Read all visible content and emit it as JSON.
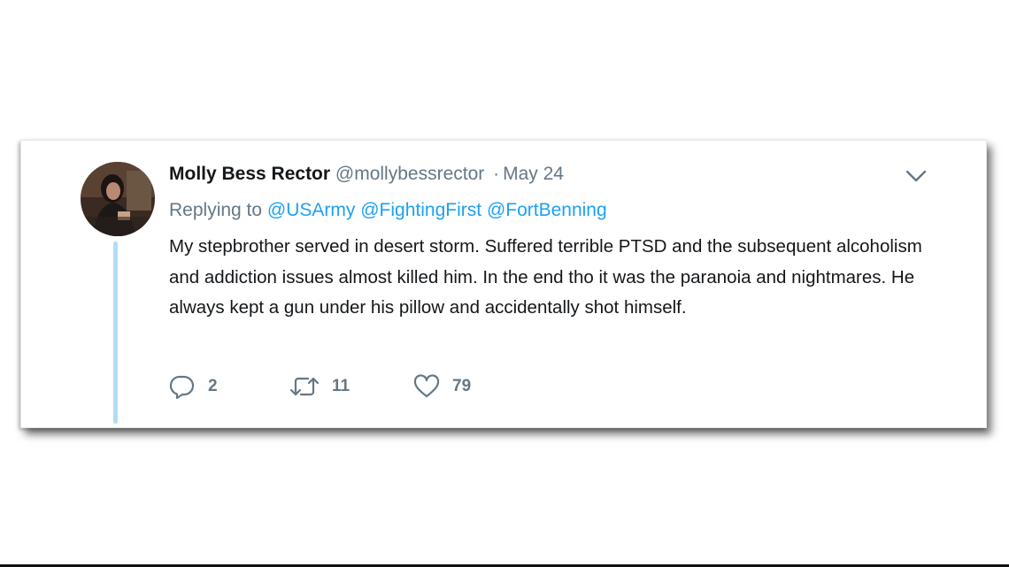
{
  "tweet": {
    "author_name": "Molly Bess Rector",
    "handle": "@mollybessrector",
    "separator": "·",
    "timestamp": "May 24",
    "replying_to_label": "Replying to",
    "mentions": [
      "@USArmy",
      "@FightingFirst",
      "@FortBenning"
    ],
    "text": "My stepbrother served in desert storm. Suffered terrible PTSD and the subsequent alcoholism and addiction issues almost killed him. In the end tho it was the paranoia and nightmares. He always kept a gun under his pillow and accidentally shot himself.",
    "actions": {
      "reply_count": "2",
      "retweet_count": "11",
      "like_count": "79"
    },
    "icons": {
      "avatar": "avatar-photo",
      "more": "chevron-down-icon",
      "reply": "reply-bubble-icon",
      "retweet": "retweet-arrows-icon",
      "like": "heart-icon"
    },
    "colors": {
      "name": "#14171a",
      "secondary": "#657786",
      "link": "#1da1f2",
      "thread_line": "#b2ddf3"
    }
  }
}
